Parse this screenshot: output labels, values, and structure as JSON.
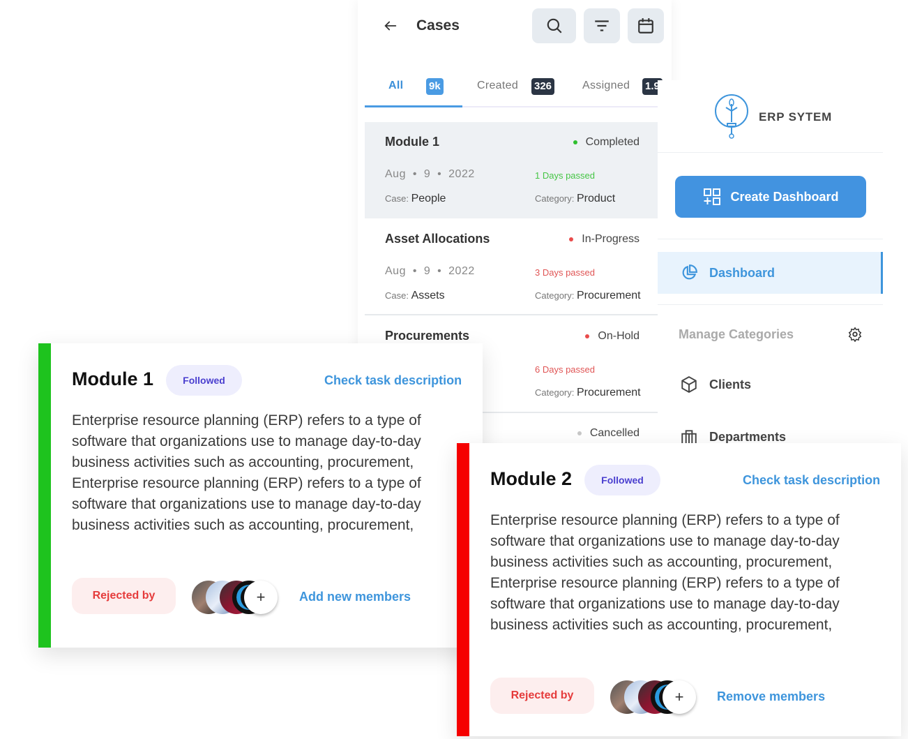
{
  "cases_panel": {
    "title": "Cases",
    "tabs": [
      {
        "label": "All",
        "count": "9k",
        "active": true
      },
      {
        "label": "Created",
        "count": "326"
      },
      {
        "label": "Assigned",
        "count": "1.9"
      }
    ],
    "rows": [
      {
        "title": "Module 1",
        "status": "Completed",
        "status_color": "#2fbf2f",
        "date": [
          "Aug",
          "9",
          "2022"
        ],
        "days_passed": "1 Days passed",
        "days_color": "#45c545",
        "case_label": "Case:",
        "case": "People",
        "category_label": "Category:",
        "category": "Product"
      },
      {
        "title": "Asset Allocations",
        "status": "In-Progress",
        "status_color": "#e94b4b",
        "date": [
          "Aug",
          "9",
          "2022"
        ],
        "days_passed": "3 Days passed",
        "days_color": "#e05555",
        "case_label": "Case:",
        "case": "Assets",
        "category_label": "Category:",
        "category": "Procurement"
      },
      {
        "title": "Procurements",
        "status": "On-Hold",
        "status_color": "#e94b4b",
        "days_passed": "6 Days passed",
        "days_color": "#e05555",
        "category_label": "Category:",
        "category": "Procurement"
      },
      {
        "status": "Cancelled",
        "status_color": "#c8c8c8"
      }
    ]
  },
  "sidebar": {
    "brand": "ERP SYTEM",
    "create_button": "Create Dashboard",
    "items": [
      {
        "label": "Dashboard",
        "icon": "pie-chart-icon",
        "active": true
      },
      {
        "label": "Manage Categories",
        "icon": "gear-icon"
      },
      {
        "label": "Clients",
        "icon": "box-icon"
      },
      {
        "label": "Departments",
        "icon": "building-icon"
      }
    ]
  },
  "cards": [
    {
      "title": "Module 1",
      "badge": "Followed",
      "link": "Check task description",
      "accent": "#1ec31e",
      "body": "Enterprise resource planning (ERP) refers to a type of software that organizations use to manage day-to-day business activities such as accounting, procurement, Enterprise resource planning (ERP) refers to a type of software that organizations use to manage day-to-day business activities such as accounting, procurement,",
      "rejected": "Rejected by",
      "members_action": "Add new members"
    },
    {
      "title": "Module 2",
      "badge": "Followed",
      "link": "Check task description",
      "accent": "#f50000",
      "body": "Enterprise resource planning (ERP) refers to a type of software that organizations use to manage day-to-day business activities such as accounting, procurement, Enterprise resource planning (ERP) refers to a type of software that organizations use to manage day-to-day business activities such as accounting, procurement,",
      "rejected": "Rejected by",
      "members_action": "Remove members"
    }
  ]
}
